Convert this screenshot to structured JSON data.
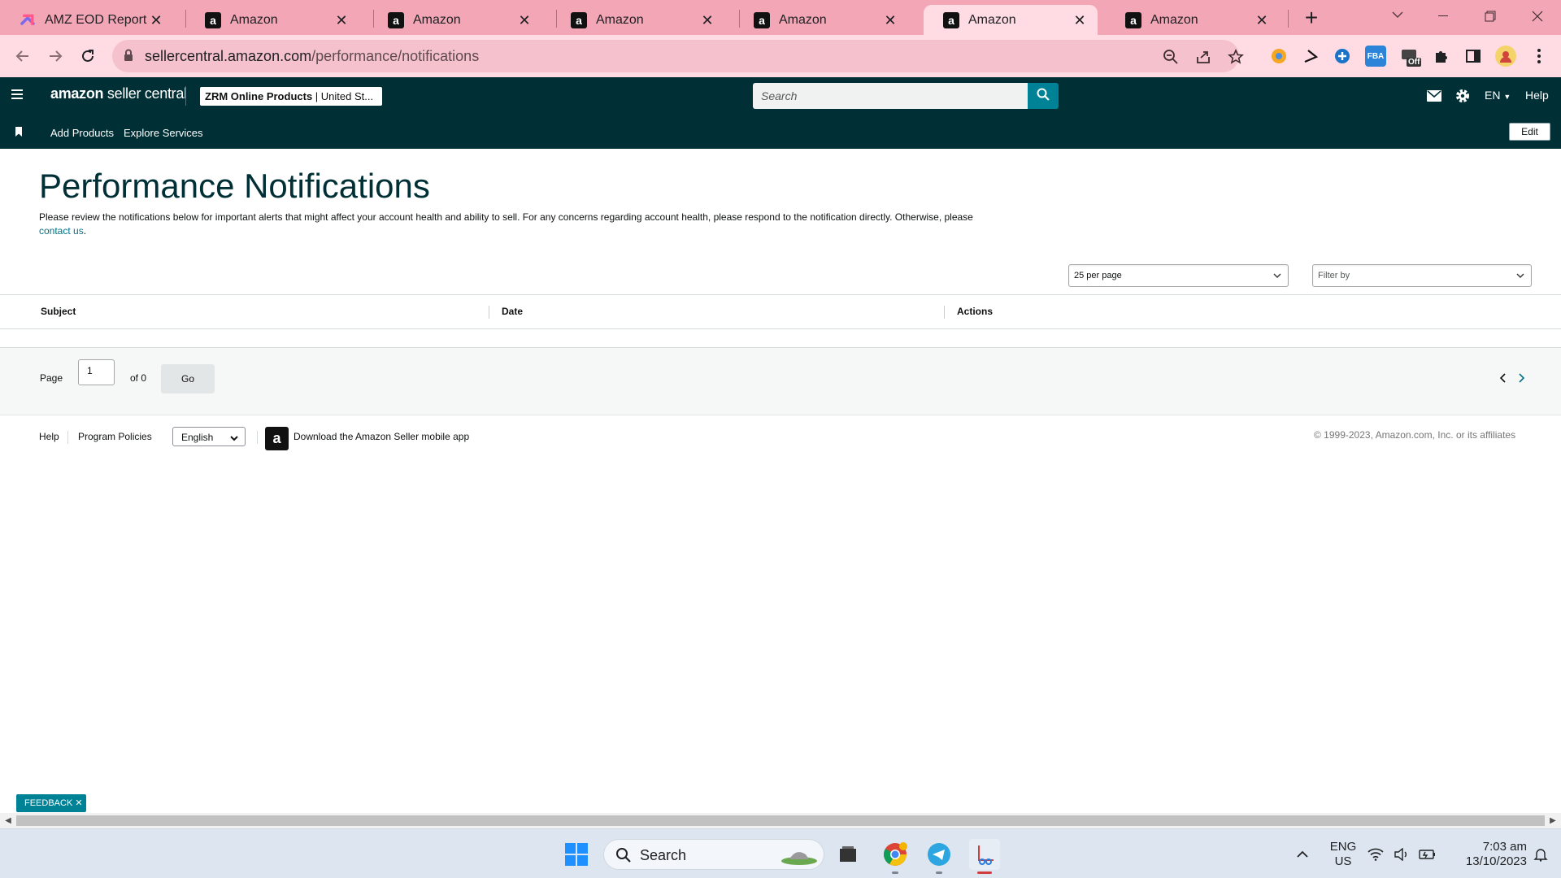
{
  "browser": {
    "tabs": [
      {
        "title": "AMZ EOD Report",
        "favicon": "clickup-icon",
        "active": false
      },
      {
        "title": "Amazon",
        "favicon": "amazon-icon",
        "active": false
      },
      {
        "title": "Amazon",
        "favicon": "amazon-icon",
        "active": false
      },
      {
        "title": "Amazon",
        "favicon": "amazon-icon",
        "active": false
      },
      {
        "title": "Amazon",
        "favicon": "amazon-icon",
        "active": false
      },
      {
        "title": "Amazon",
        "favicon": "amazon-icon",
        "active": true
      },
      {
        "title": "Amazon",
        "favicon": "amazon-icon",
        "active": false
      }
    ],
    "url_host": "sellercentral.amazon.com",
    "url_path": "/performance/notifications",
    "extension_fba_label": "FBA",
    "extension_off_label": "Off"
  },
  "header": {
    "logo_brand": "amazon",
    "logo_product": "seller central",
    "account_name": "ZRM Online Products",
    "account_region": "United St...",
    "search_placeholder": "Search",
    "language": "EN",
    "help_label": "Help"
  },
  "subnav": {
    "items": [
      "Add Products",
      "Explore Services"
    ],
    "edit_label": "Edit"
  },
  "page": {
    "title": "Performance Notifications",
    "description": "Please review the notifications below for important alerts that might affect your account health and ability to sell. For any concerns regarding account health, please respond to the notification directly. Otherwise, please",
    "contact_link": "contact us",
    "per_page": "25 per page",
    "filter_placeholder": "Filter by"
  },
  "table": {
    "columns": [
      "Subject",
      "Date",
      "Actions"
    ],
    "rows": []
  },
  "pagination": {
    "page_label": "Page",
    "current_page": "1",
    "of_label": "of 0",
    "go_label": "Go"
  },
  "footer": {
    "help": "Help",
    "program_policies": "Program Policies",
    "language": "English",
    "app_download": "Download the Amazon Seller mobile app",
    "copyright": "© 1999-2023, Amazon.com, Inc. or its affiliates"
  },
  "feedback_label": "FEEDBACK",
  "taskbar": {
    "search_label": "Search",
    "lang_line1": "ENG",
    "lang_line2": "US",
    "time": "7:03 am",
    "date": "13/10/2023"
  },
  "colors": {
    "tab_strip": "#f3a6b6",
    "header_bg": "#002f36",
    "accent": "#008296",
    "link": "#007185"
  }
}
